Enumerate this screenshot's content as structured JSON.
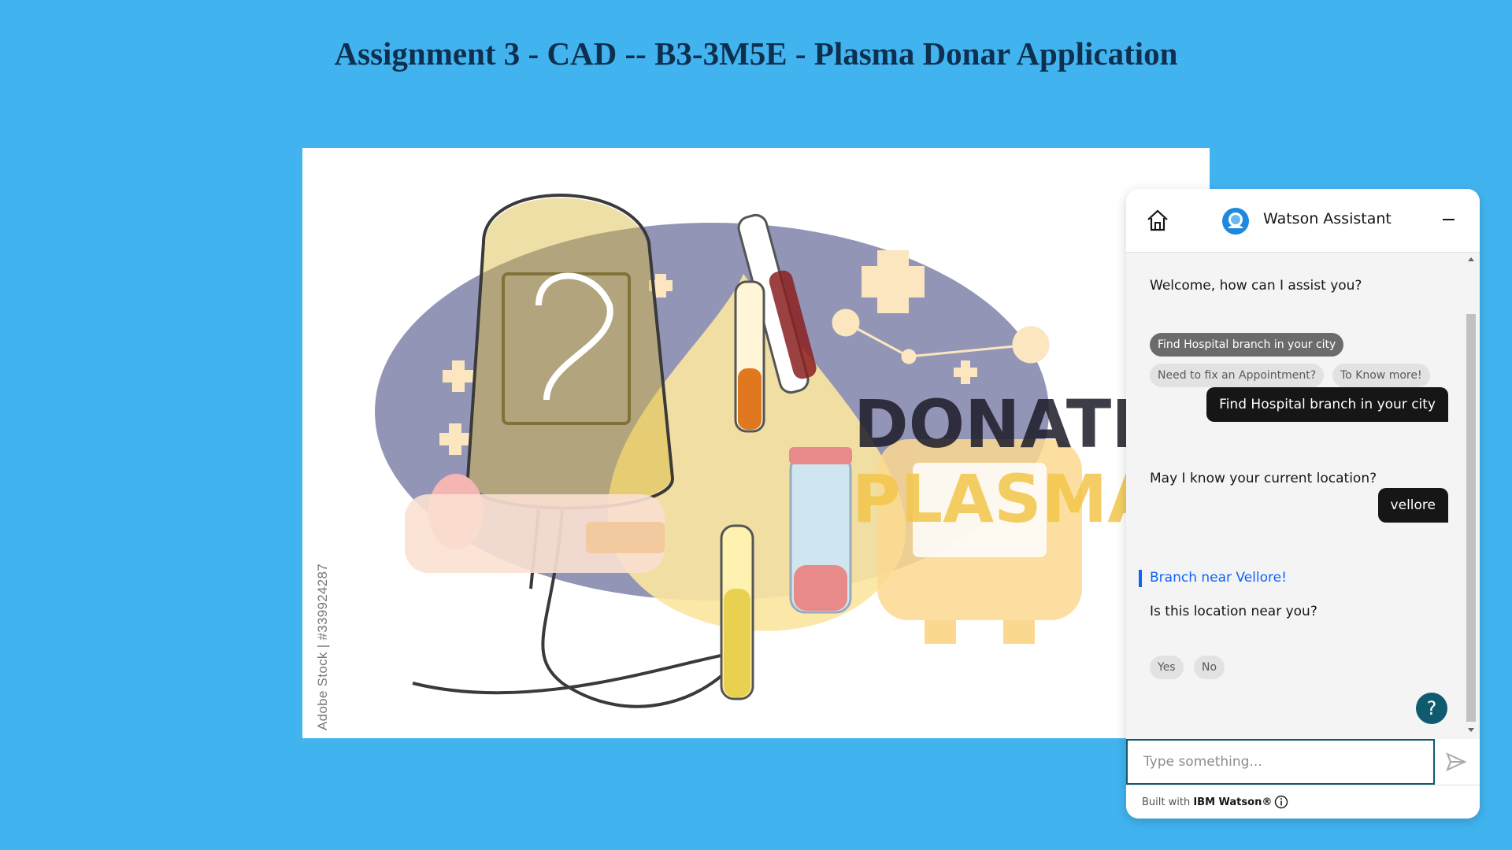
{
  "page": {
    "title": "Assignment 3 - CAD -- B3-3M5E - Plasma Donar Application"
  },
  "hero": {
    "donate_text": "DONATE",
    "plasma_text": "PLASMA",
    "side_watermark": "Adobe Stock | #339924287"
  },
  "chat": {
    "header_title": "Watson Assistant",
    "icons": {
      "home": "home-icon",
      "avatar": "watson-avatar-icon",
      "minimize": "minimize-icon",
      "send": "send-icon",
      "info": "info-icon",
      "help": "help-icon"
    },
    "messages": {
      "welcome": "Welcome, how can I assist you?",
      "options": [
        "Find Hospital branch in your city",
        "Need to fix an Appointment?",
        "To Know more!"
      ],
      "user_1": "Find Hospital branch in your city",
      "ask_location": "May I know your current location?",
      "user_2": "vellore",
      "branch_link": "Branch near Vellore!",
      "confirm_question": "Is this location near you?",
      "yes": "Yes",
      "no": "No"
    },
    "help_label": "?",
    "input_placeholder": "Type something...",
    "footer_prefix": "Built with ",
    "footer_brand": "IBM Watson®"
  }
}
